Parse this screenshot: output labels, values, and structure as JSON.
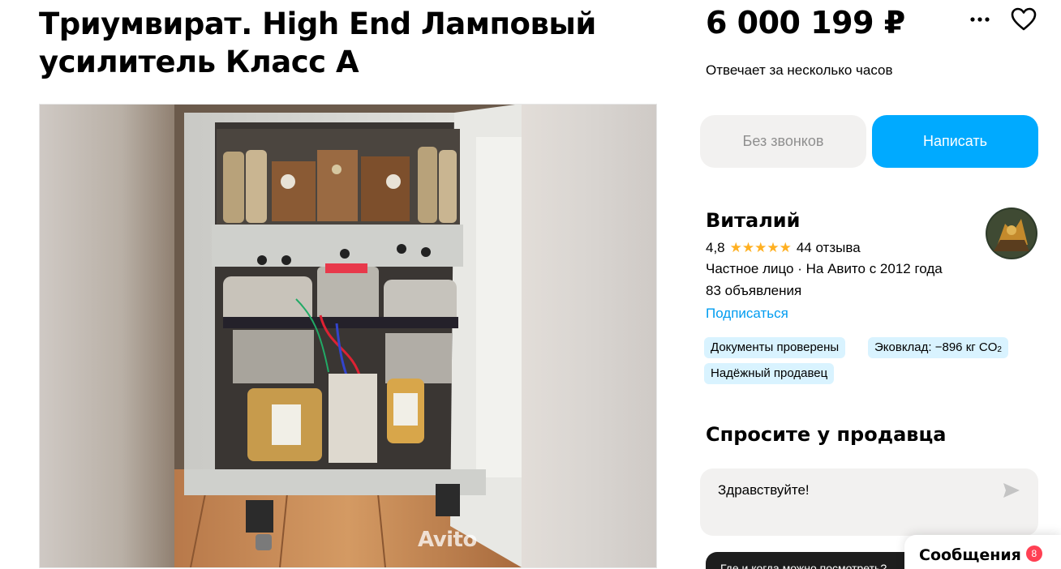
{
  "listing": {
    "title": "Триумвират. High End Ламповый усилитель Класс А",
    "price": "6 000 199 ₽",
    "response_time": "Отвечает за несколько часов",
    "watermark": "Avito"
  },
  "actions": {
    "no_calls_label": "Без звонков",
    "write_label": "Написать",
    "more_icon": "more-dots-icon",
    "favorite_icon": "heart-icon"
  },
  "seller": {
    "name": "Виталий",
    "rating": "4,8",
    "stars": "★★★★★",
    "reviews": "44 отзыва",
    "type_since": "Частное лицо · На Авито с 2012 года",
    "listings_count": "83 объявления",
    "subscribe_label": "Подписаться",
    "badges": {
      "docs": "Документы проверены",
      "eco": "Эковклад: −896 кг CO",
      "eco_sub": "2",
      "reliable": "Надёжный продавец"
    }
  },
  "ask": {
    "title": "Спросите у продавца",
    "message_value": "Здравствуйте!",
    "banner_text": "Где и когда можно посмотреть?"
  },
  "messenger": {
    "label": "Сообщения",
    "count": "8"
  },
  "colors": {
    "accent": "#00aaff",
    "link": "#009cf0",
    "star": "#ffb021",
    "badge_bg": "#d9f3ff",
    "notification": "#ff4053"
  }
}
